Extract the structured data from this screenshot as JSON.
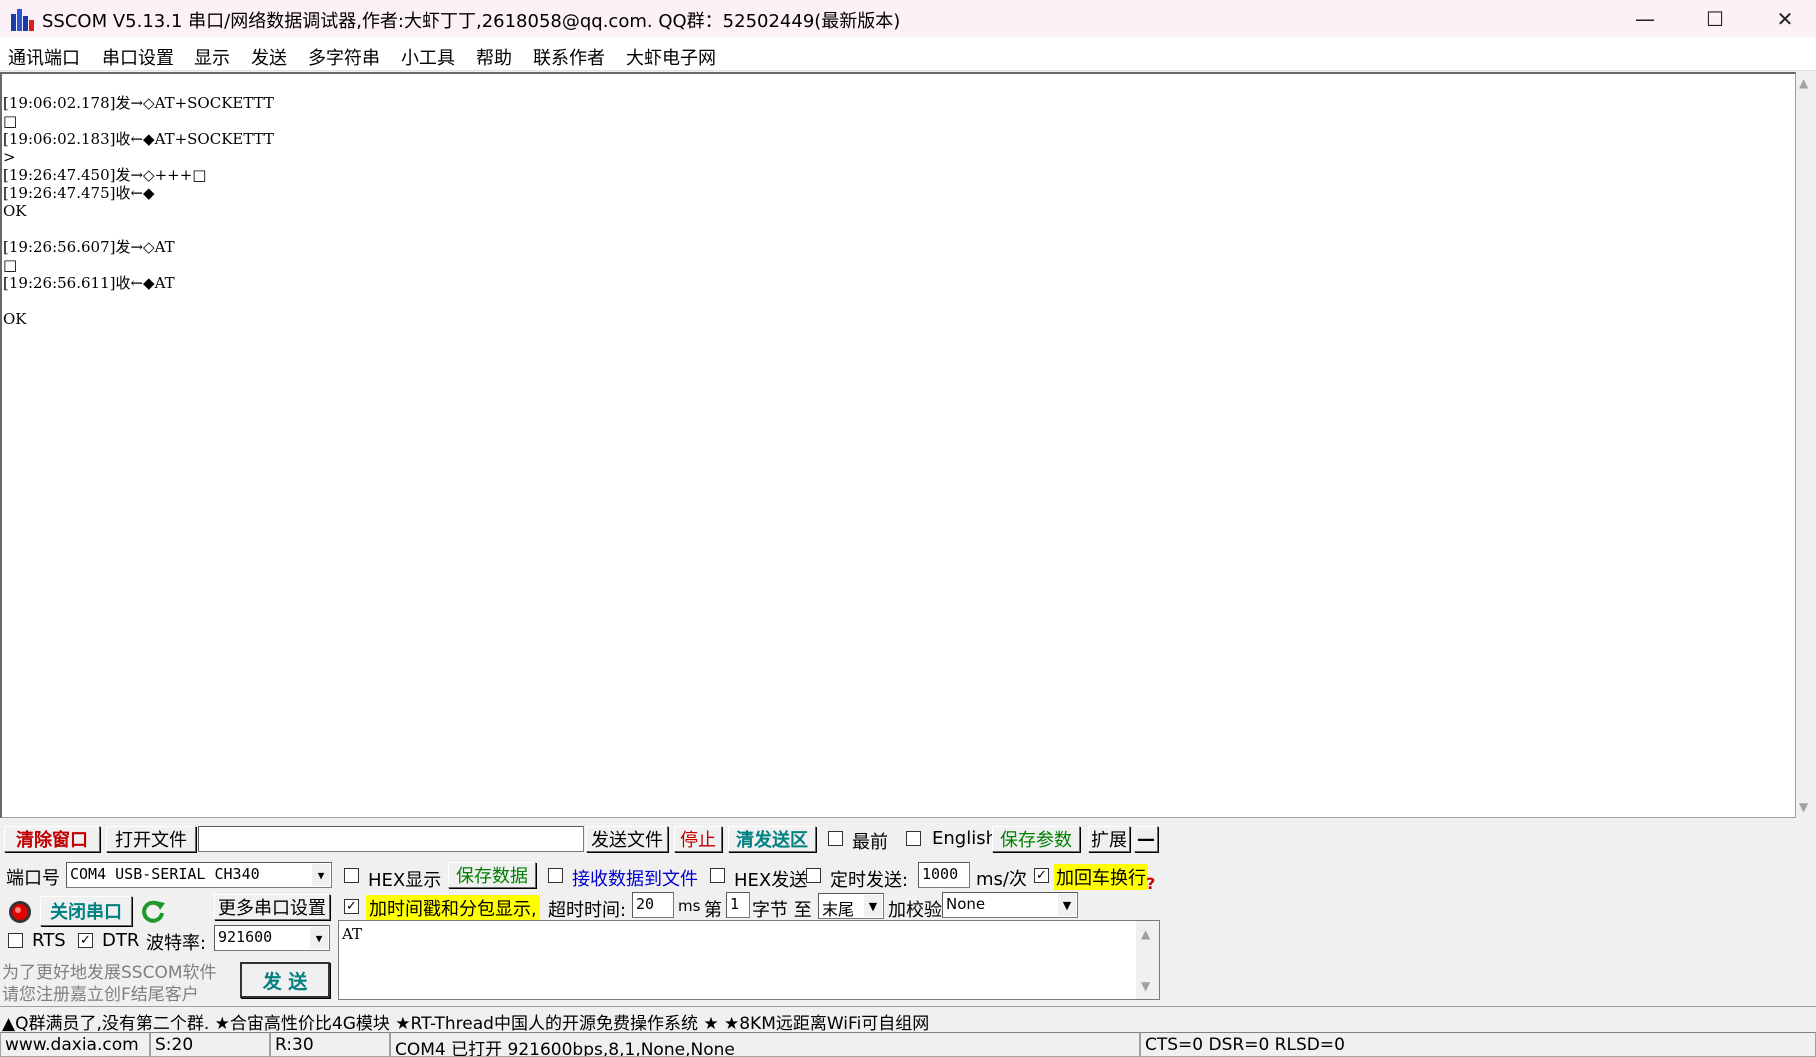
{
  "window": {
    "title": "SSCOM V5.13.1 串口/网络数据调试器,作者:大虾丁丁,2618058@qq.com. QQ群：52502449(最新版本)",
    "minimize": "—",
    "maximize": "☐",
    "close": "✕"
  },
  "menu": [
    "通讯端口",
    "串口设置",
    "显示",
    "发送",
    "多字符串",
    "小工具",
    "帮助",
    "联系作者",
    "大虾电子网"
  ],
  "receive": {
    "lines": [
      "[19:06:02.178]发→◇AT+SOCKETTT",
      "□",
      "[19:06:02.183]收←◆AT+SOCKETTT",
      ">",
      "[19:26:47.450]发→◇+++□",
      "[19:26:47.475]收←◆",
      "OK",
      "",
      "[19:26:56.607]发→◇AT",
      "□",
      "[19:26:56.611]收←◆AT",
      "",
      "OK"
    ]
  },
  "toolbar": {
    "clear_window": "清除窗口",
    "open_file": "打开文件",
    "file_path": "",
    "send_file": "发送文件",
    "stop": "停止",
    "clear_send": "清发送区",
    "topmost": "最前",
    "english": "English",
    "save_params": "保存参数",
    "expand": "扩展",
    "collapse": "—"
  },
  "port": {
    "port_label": "端口号",
    "port_value": "COM4 USB-SERIAL CH340",
    "close_port": "关闭串口",
    "more_settings": "更多串口设置",
    "rts": "RTS",
    "dtr": "DTR",
    "baud_label": "波特率:",
    "baud_value": "921600",
    "promo_line1": "为了更好地发展SSCOM软件",
    "promo_line2": "请您注册嘉立创F结尾客户",
    "send": "发  送"
  },
  "options": {
    "hex_display": "HEX显示",
    "save_data": "保存数据",
    "recv_to_file": "接收数据到文件",
    "hex_send": "HEX发送",
    "timed_send": "定时发送:",
    "interval": "1000",
    "interval_unit": "ms/次",
    "add_crlf": "加回车换行",
    "timestamp": "加时间戳和分包显示,",
    "timeout_label": "超时时间:",
    "timeout_value": "20",
    "timeout_unit": "ms",
    "byte_from_label": "第",
    "byte_from_value": "1",
    "byte_to_label": "字节 至",
    "byte_to_value": "末尾",
    "checksum_label": "加校验",
    "checksum_value": "None",
    "help_mark": "?"
  },
  "send_text": "AT",
  "ticker": "▲Q群满员了,没有第二个群. ★合宙高性价比4G模块 ★RT-Thread中国人的开源免费操作系统 ★ ★8KM远距离WiFi可自组网",
  "status": {
    "website": "www.daxia.com",
    "sent": "S:20",
    "received": "R:30",
    "port_state": "COM4 已打开  921600bps,8,1,None,None",
    "signals": "CTS=0 DSR=0 RLSD=0"
  },
  "colors": {
    "title_bg": "#fbf1f6",
    "highlight": "#ffff00",
    "accent_red": "#c00000",
    "accent_green": "#008000",
    "accent_teal": "#008080"
  }
}
